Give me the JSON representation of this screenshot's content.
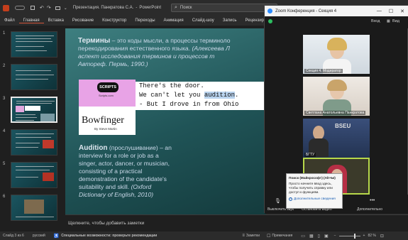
{
  "titlebar": {
    "file_title": "Презентация. Панкратова С.А.",
    "app_name": "PowerPoint",
    "search_placeholder": "Поиск"
  },
  "ribbon": {
    "tabs": [
      "Файл",
      "Главная",
      "Вставка",
      "Рисование",
      "Конструктор",
      "Переходы",
      "Анимация",
      "Слайд-шоу",
      "Запись",
      "Рецензирование"
    ],
    "active_index": 1
  },
  "thumbnails": {
    "numbers": [
      "1",
      "2",
      "3",
      "4",
      "5",
      "6"
    ],
    "selected_index": 2
  },
  "slide": {
    "term_head": "Термины",
    "term_text_1": " – это коды мысли, а процессы терминоло",
    "term_text_2": "перекодирования естественного языка.",
    "term_ref_1": "(Алексеева Л",
    "term_ref_2": "аспект исследования терминов и процессов т",
    "term_ref_3": "Автореф. Пермь, 1990.)",
    "scripts_logo": "SCRIPTS",
    "scripts_site": "Scripts.com",
    "movie_title": "Bowfinger",
    "movie_author": "By Steve Martin",
    "script_line_1": "There's the door.",
    "script_line_2_a": "We can't let you ",
    "script_line_2_hl": "audition",
    "script_line_2_b": ".",
    "script_line_3": "- But I drove in from Ohio",
    "audition_head": "Audition",
    "audition_text_1": " (прослушивание) – an",
    "audition_text_2": "interview for a role or job as a",
    "audition_text_3": "singer, actor, dancer, or musician,",
    "audition_text_4": "consisting of a practical",
    "audition_text_5": "demonstration of the candidate's",
    "audition_text_6": "suitability and skill.",
    "audition_ref_1": "(Oxford",
    "audition_ref_2": "Dictionary of English, 2010)"
  },
  "notes_placeholder": "Щелкните, чтобы добавить заметки",
  "status": {
    "slide_count": "Слайд 3 из 6",
    "language": "русский",
    "accessibility": "Специальные возможности: проверьте рекомендации",
    "notes": "Заметки",
    "comments": "Примечания",
    "zoom": "82 %"
  },
  "zoom_window": {
    "title": "Zoom Конференция - Секция 4",
    "view_label": "Вид",
    "enter_label": "Вход",
    "participants": [
      {
        "label": "Секция 4. Модератор"
      },
      {
        "label": "Светлана Анатольевна Панкратова"
      },
      {
        "label": "БГТУ"
      },
      {
        "label": ""
      }
    ],
    "bottom": {
      "mute": "Выключить звук",
      "video": "Остановить видео",
      "more": "Дополнительно"
    },
    "tooltip": {
      "title": "Поиск (Майкрософт) (Alt+Ы)",
      "body": "Просто начните ввод здесь, чтобы получить справку или доступ к функциям.",
      "link": "Дополнительные сведения"
    }
  }
}
